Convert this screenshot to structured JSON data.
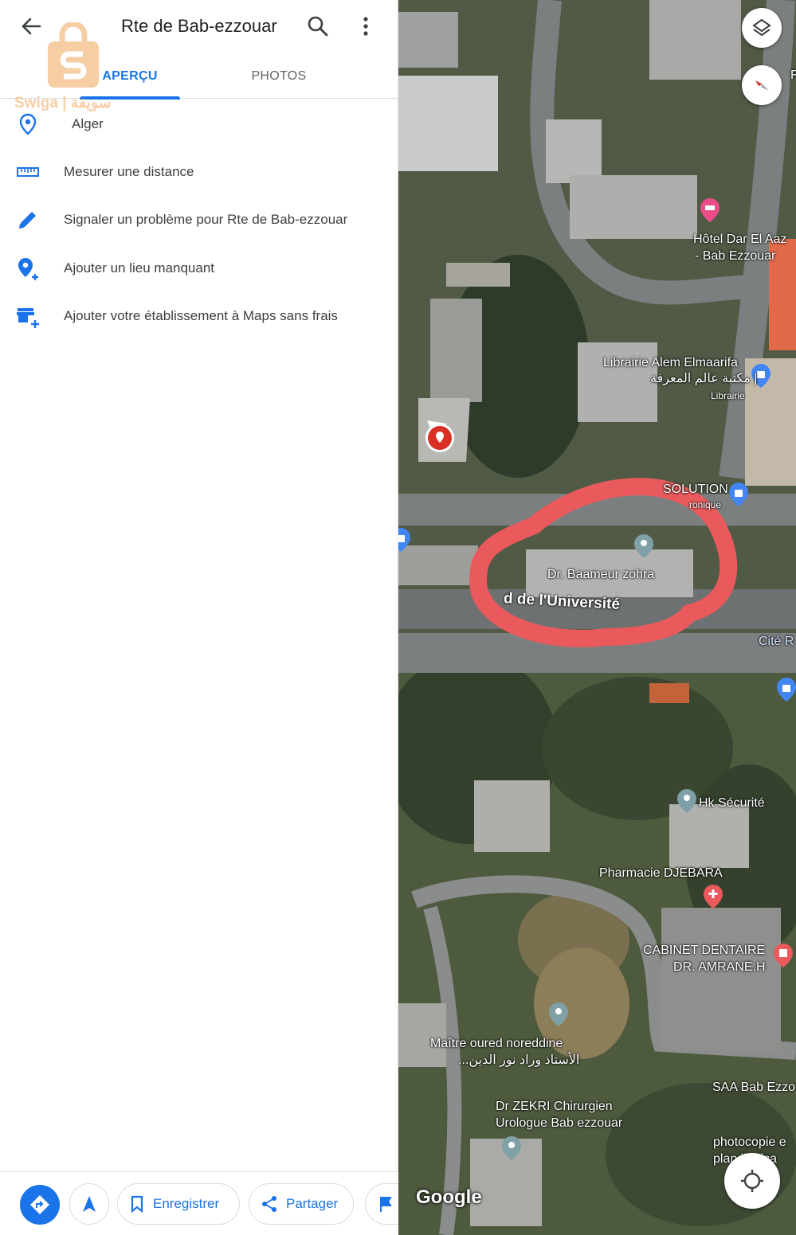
{
  "appbar": {
    "title": "Rte de Bab-ezzouar"
  },
  "tabs": [
    {
      "label": "APERÇU",
      "active": true
    },
    {
      "label": "PHOTOS",
      "active": false
    }
  ],
  "watermark": {
    "text": "Swiga | سويقة"
  },
  "actions": [
    {
      "icon": "location-pin-icon",
      "label": "Alger"
    },
    {
      "icon": "ruler-icon",
      "label": "Mesurer une distance"
    },
    {
      "icon": "pencil-icon",
      "label": "Signaler un problème pour Rte de Bab-ezzouar"
    },
    {
      "icon": "add-location-icon",
      "label": "Ajouter un lieu manquant"
    },
    {
      "icon": "add-business-icon",
      "label": "Ajouter votre établissement à Maps sans frais"
    }
  ],
  "bottombar": {
    "save_label": "Enregistrer",
    "share_label": "Partager"
  },
  "map": {
    "labels": {
      "hotel_1": "Hôtel Dar El Aaz",
      "hotel_2": "- Bab Ezzouar",
      "librairie_1": "Librairie Alem Elmaarifa",
      "librairie_2": "مكتبة عالم المعرفة |",
      "librairie_3": "Librairie",
      "solution_1": "SOLUTION",
      "solution_2": "ronique",
      "doctor": "Dr. Baameur zohra",
      "road": "d de l'Université",
      "cite": "Cité R",
      "hk": "Hk Sécurité",
      "pharmacie": "Pharmacie DJEBARA",
      "cabinet_1": "CABINET DENTAIRE",
      "cabinet_2": "DR. AMRANE.H",
      "maitre_1": "Maître oured noreddine",
      "maitre_2": "...الأستاذ وراد نور الدين",
      "saa": "SAA Bab Ezzo",
      "zekri_1": "Dr ZEKRI Chirurgien",
      "zekri_2": "Urologue Bab ezzouar",
      "photocopie_1": "photocopie e",
      "photocopie_2": "plan ilogica",
      "edge_f": "F"
    },
    "google": "Google"
  }
}
